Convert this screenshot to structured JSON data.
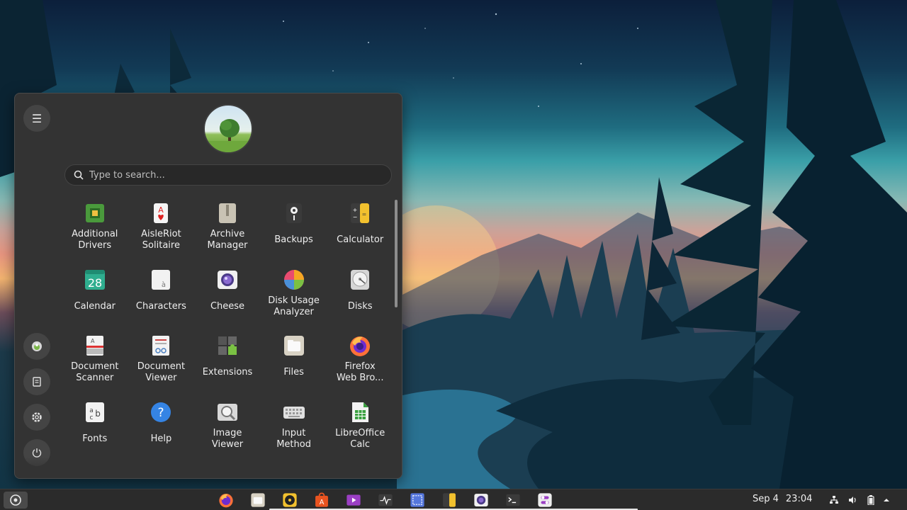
{
  "search": {
    "placeholder": "Type to search..."
  },
  "apps": [
    {
      "label": "Additional\nDrivers",
      "icon": "chip-icon"
    },
    {
      "label": "AisleRiot\nSolitaire",
      "icon": "playing-card-icon"
    },
    {
      "label": "Archive\nManager",
      "icon": "archive-icon"
    },
    {
      "label": "Backups",
      "icon": "backup-icon"
    },
    {
      "label": "Calculator",
      "icon": "calculator-icon"
    },
    {
      "label": "Calendar",
      "icon": "calendar-icon",
      "day": "28"
    },
    {
      "label": "Characters",
      "icon": "characters-icon"
    },
    {
      "label": "Cheese",
      "icon": "cheese-icon"
    },
    {
      "label": "Disk Usage\nAnalyzer",
      "icon": "disk-usage-icon"
    },
    {
      "label": "Disks",
      "icon": "disks-icon"
    },
    {
      "label": "Document\nScanner",
      "icon": "scanner-icon"
    },
    {
      "label": "Document\nViewer",
      "icon": "document-viewer-icon"
    },
    {
      "label": "Extensions",
      "icon": "puzzle-icon"
    },
    {
      "label": "Files",
      "icon": "folder-icon"
    },
    {
      "label": "Firefox\nWeb Bro...",
      "icon": "firefox-icon"
    },
    {
      "label": "Fonts",
      "icon": "fonts-icon"
    },
    {
      "label": "Help",
      "icon": "help-icon"
    },
    {
      "label": "Image\nViewer",
      "icon": "image-viewer-icon"
    },
    {
      "label": "Input\nMethod",
      "icon": "keyboard-icon"
    },
    {
      "label": "LibreOffice\nCalc",
      "icon": "spreadsheet-icon"
    }
  ],
  "taskbar": {
    "date": "Sep 4",
    "time": "23:04"
  },
  "colors": {
    "menu_bg": "#333333",
    "taskbar_bg": "#2b2b2b",
    "accent": "#4a90d9"
  }
}
